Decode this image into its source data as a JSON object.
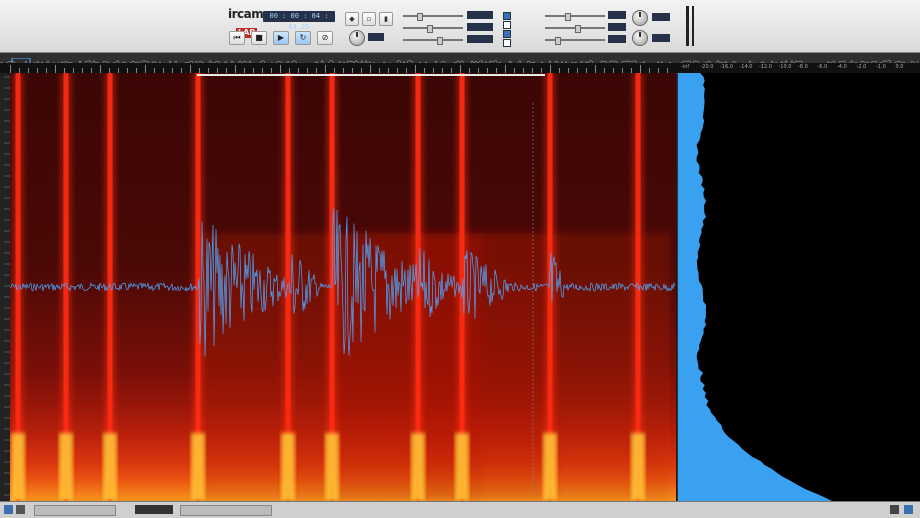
{
  "app": {
    "logo_line1": "ircam",
    "logo_line2": "LAB",
    "time": "00 : 00 : 04 : 63.25"
  },
  "spectrum_scale_labels": [
    "-inf",
    "-20.0",
    "-16.0",
    "-14.0",
    "-12.0",
    "-10.0",
    "-8.0",
    "-6.0",
    "-4.0",
    "-2.0",
    "-1.0",
    "0.0"
  ],
  "colors": {
    "waveform": "#4ea7ff",
    "spectrum_fill": "#3aa0f0",
    "spectrogram_dark": "#3a0605",
    "spectrogram_hot": "#ffe23a"
  },
  "icons": {
    "transport": [
      "skip-to-start-icon",
      "stop-icon",
      "play-icon",
      "loop-icon",
      "record-icon"
    ]
  }
}
